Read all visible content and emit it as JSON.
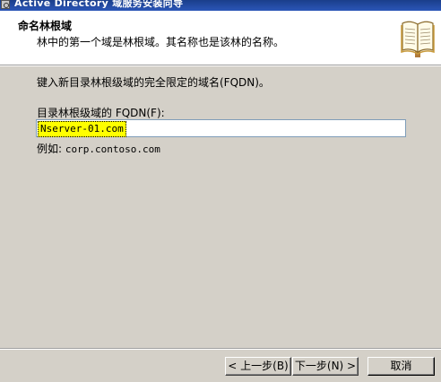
{
  "window": {
    "title_latin": "Active Directory",
    "title_cjk": "域服务安装向导"
  },
  "header": {
    "title": "命名林根域",
    "subtitle": "林中的第一个域是林根域。其名称也是该林的名称。"
  },
  "main": {
    "instruction": "键入新目录林根级域的完全限定的域名(FQDN)。",
    "field_label": "目录林根级域的 FQDN(F):",
    "fqdn_value": "Nserver-01.com",
    "example_prefix": "例如:",
    "example_value": "corp.contoso.com"
  },
  "buttons": {
    "back": "< 上一步(B)",
    "next": "下一步(N) >",
    "cancel": "取消"
  },
  "colors": {
    "highlight": "#ffff00",
    "dialog_bg": "#d4d0c8",
    "titlebar": "#2b56b8"
  },
  "icons": {
    "app": "window-icon",
    "header": "open-book-icon"
  }
}
